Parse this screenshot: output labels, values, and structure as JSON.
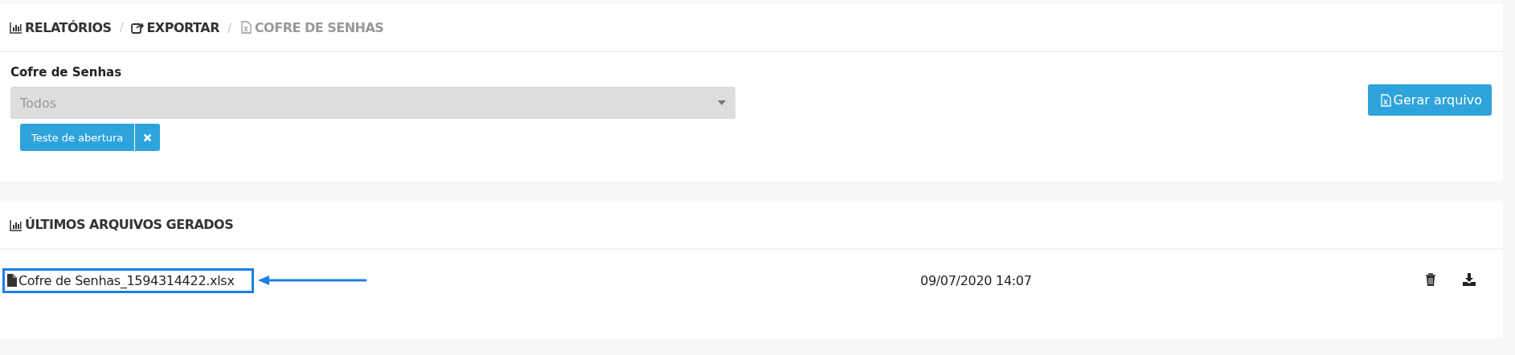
{
  "breadcrumb": [
    {
      "label": "RELATÓRIOS",
      "kind": "chart",
      "current": false
    },
    {
      "separator": "/",
      "label": "EXPORTAR",
      "kind": "share",
      "current": false
    },
    {
      "separator": "/",
      "label": "COFRE DE SENHAS",
      "kind": "excel",
      "current": true
    }
  ],
  "filter": {
    "label": "Cofre de Senhas",
    "placeholder": "Todos",
    "tags": [
      {
        "label": "Teste de abertura"
      }
    ]
  },
  "generate_button": {
    "label": "Gerar arquivo"
  },
  "files_section": {
    "title": "ÚLTIMOS ARQUIVOS GERADOS",
    "rows": [
      {
        "name": "Cofre de Senhas_1594314422.xlsx",
        "date": "09/07/2020 14:07",
        "highlighted": true
      }
    ]
  }
}
